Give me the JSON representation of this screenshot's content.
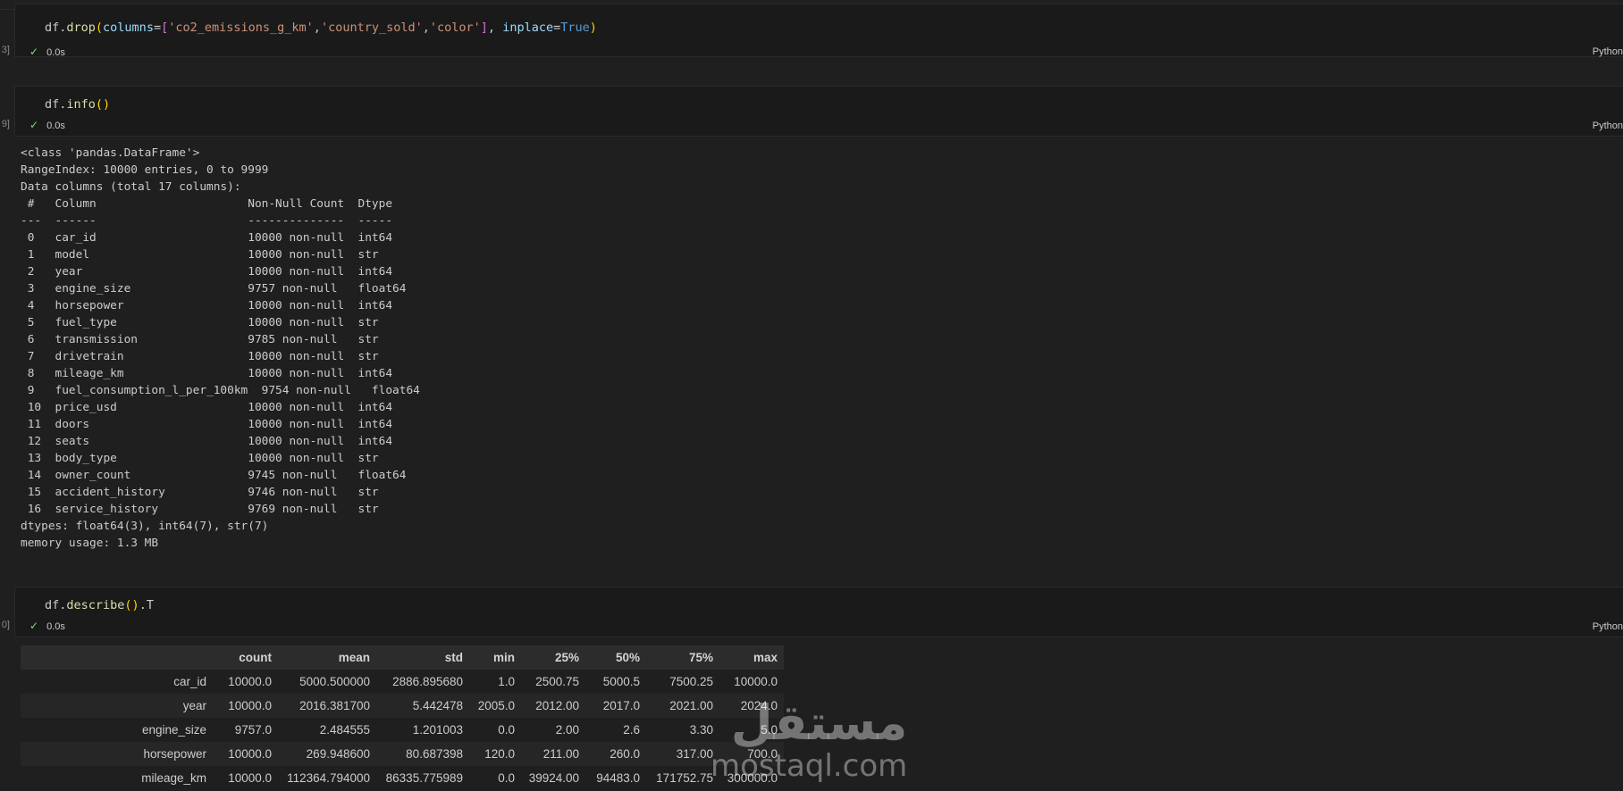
{
  "cells": [
    {
      "code": {
        "pre": "df.",
        "fn": "drop",
        "open": "(",
        "kw": "columns",
        "eq": "=",
        "br_open": "[",
        "s1": "'co2_emissions_g_km'",
        "c1": ",",
        "s2": "'country_sold'",
        "c2": ",",
        "s3": "'color'",
        "br_close": "]",
        "sep": ", ",
        "kw2": "inplace",
        "eq2": "=",
        "const": "True",
        "close": ")"
      },
      "exec_count": "3]",
      "time": "0.0s",
      "language": "Python"
    },
    {
      "code": {
        "pre": "df.",
        "fn": "info",
        "paren": "()"
      },
      "exec_count": "9]",
      "time": "0.0s",
      "language": "Python",
      "output": "<class 'pandas.DataFrame'>\nRangeIndex: 10000 entries, 0 to 9999\nData columns (total 17 columns):\n #   Column                      Non-Null Count  Dtype  \n---  ------                      --------------  -----  \n 0   car_id                      10000 non-null  int64  \n 1   model                       10000 non-null  str    \n 2   year                        10000 non-null  int64  \n 3   engine_size                 9757 non-null   float64\n 4   horsepower                  10000 non-null  int64  \n 5   fuel_type                   10000 non-null  str    \n 6   transmission                9785 non-null   str    \n 7   drivetrain                  10000 non-null  str    \n 8   mileage_km                  10000 non-null  int64  \n 9   fuel_consumption_l_per_100km  9754 non-null   float64\n 10  price_usd                   10000 non-null  int64  \n 11  doors                       10000 non-null  int64  \n 12  seats                       10000 non-null  int64  \n 13  body_type                   10000 non-null  str    \n 14  owner_count                 9745 non-null   float64\n 15  accident_history            9746 non-null   str    \n 16  service_history             9769 non-null   str    \ndtypes: float64(3), int64(7), str(7)\nmemory usage: 1.3 MB"
    },
    {
      "code": {
        "pre": "df.",
        "fn": "describe",
        "paren": "()",
        "post": ".T"
      },
      "exec_count": "0]",
      "time": "0.0s",
      "language": "Python"
    }
  ],
  "describe_table": {
    "headers": [
      "",
      "count",
      "mean",
      "std",
      "min",
      "25%",
      "50%",
      "75%",
      "max"
    ],
    "rows": [
      [
        "car_id",
        "10000.0",
        "5000.500000",
        "2886.895680",
        "1.0",
        "2500.75",
        "5000.5",
        "7500.25",
        "10000.0"
      ],
      [
        "year",
        "10000.0",
        "2016.381700",
        "5.442478",
        "2005.0",
        "2012.00",
        "2017.0",
        "2021.00",
        "2024.0"
      ],
      [
        "engine_size",
        "9757.0",
        "2.484555",
        "1.201003",
        "0.0",
        "2.00",
        "2.6",
        "3.30",
        "5.0"
      ],
      [
        "horsepower",
        "10000.0",
        "269.948600",
        "80.687398",
        "120.0",
        "211.00",
        "260.0",
        "317.00",
        "700.0"
      ],
      [
        "mileage_km",
        "10000.0",
        "112364.794000",
        "86335.775989",
        "0.0",
        "39924.00",
        "94483.0",
        "171752.75",
        "300000.0"
      ]
    ]
  },
  "watermark": {
    "arabic": "مستقل",
    "latin": "mostaql.com"
  }
}
